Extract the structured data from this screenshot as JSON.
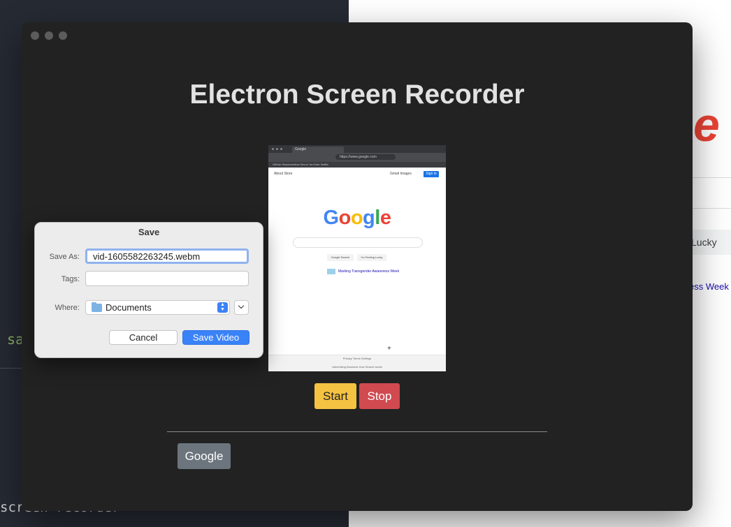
{
  "background": {
    "editor_fragment_1": "sa",
    "editor_fragment_2": "screen-recorder",
    "web_logo_letter": "e",
    "web_lucky": "Lucky",
    "web_week": "ess Week"
  },
  "app": {
    "title": "Electron Screen Recorder",
    "start_label": "Start",
    "stop_label": "Stop",
    "google_label": "Google",
    "colors": {
      "start": "#f5c242",
      "stop": "#d04a50",
      "google": "#6c757d"
    }
  },
  "preview": {
    "tab_title": "Google",
    "url": "https://www.google.com",
    "bookmarks": "GitHub  Stackoverflow  Dev.to  YouTube  Netflix",
    "links_left": "About  Store",
    "links_right": "Gmail  Images",
    "signin": "Sign in",
    "logo": {
      "g1": "G",
      "o1": "o",
      "o2": "o",
      "g2": "g",
      "l": "l",
      "e": "e"
    },
    "search_btn": "Google Search",
    "lucky_btn": "I'm Feeling Lucky",
    "promo": "Marking Transgender Awareness Week",
    "footer_1": "Privacy   Terms   Settings",
    "footer_2": "Advertising   Business   How Search works"
  },
  "dialog": {
    "title": "Save",
    "save_as_label": "Save As:",
    "save_as_value": "vid-1605582263245.webm",
    "tags_label": "Tags:",
    "tags_value": "",
    "where_label": "Where:",
    "where_value": "Documents",
    "cancel_label": "Cancel",
    "save_label": "Save Video"
  }
}
